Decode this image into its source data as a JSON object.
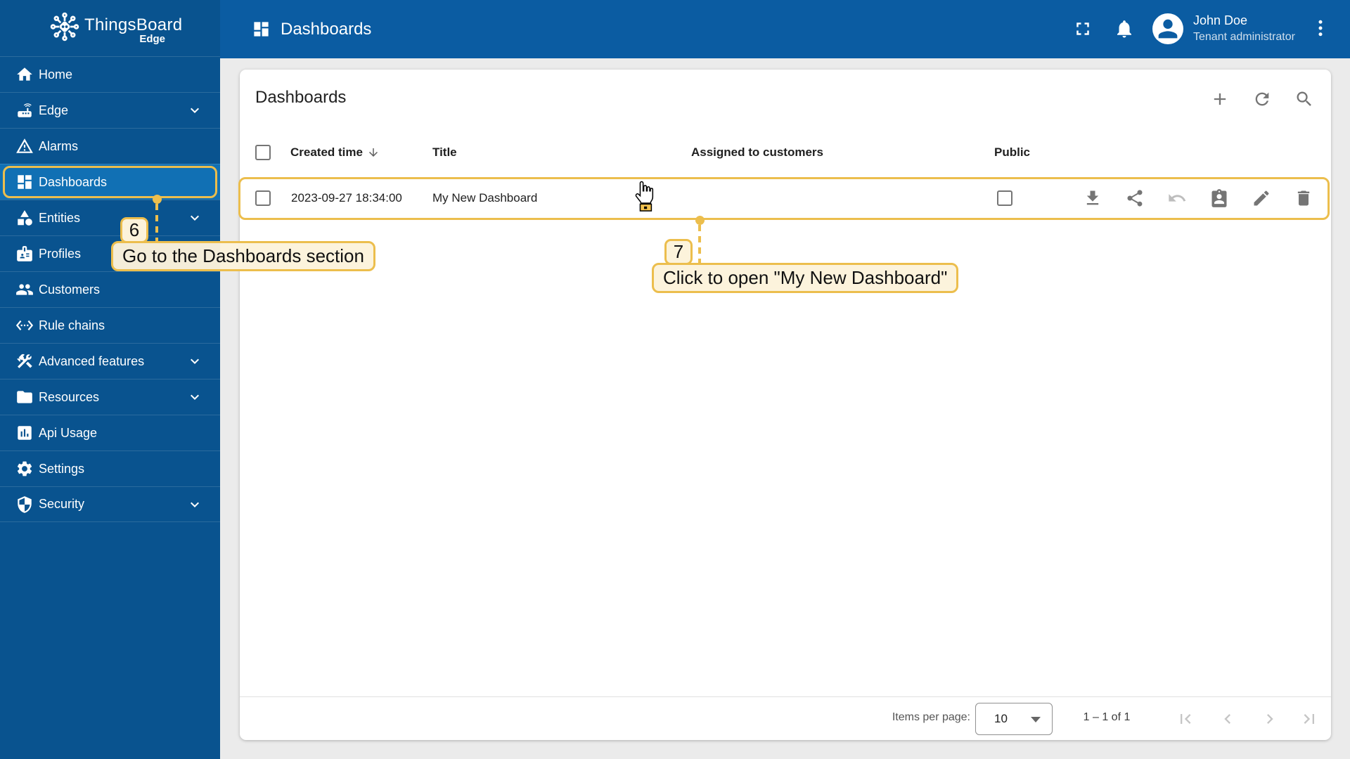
{
  "sidebar": {
    "logo": {
      "title": "ThingsBoard",
      "subtitle": "Edge"
    },
    "items": [
      {
        "label": "Home",
        "expandable": false,
        "selected": false
      },
      {
        "label": "Edge",
        "expandable": true,
        "selected": false
      },
      {
        "label": "Alarms",
        "expandable": false,
        "selected": false
      },
      {
        "label": "Dashboards",
        "expandable": false,
        "selected": true
      },
      {
        "label": "Entities",
        "expandable": true,
        "selected": false
      },
      {
        "label": "Profiles",
        "expandable": false,
        "selected": false
      },
      {
        "label": "Customers",
        "expandable": false,
        "selected": false
      },
      {
        "label": "Rule chains",
        "expandable": false,
        "selected": false
      },
      {
        "label": "Advanced features",
        "expandable": true,
        "selected": false
      },
      {
        "label": "Resources",
        "expandable": true,
        "selected": false
      },
      {
        "label": "Api Usage",
        "expandable": false,
        "selected": false
      },
      {
        "label": "Settings",
        "expandable": false,
        "selected": false
      },
      {
        "label": "Security",
        "expandable": true,
        "selected": false
      }
    ]
  },
  "header": {
    "title": "Dashboards",
    "user": {
      "name": "John Doe",
      "role": "Tenant administrator"
    }
  },
  "content": {
    "title": "Dashboards",
    "table": {
      "columns": {
        "created_time": "Created time",
        "title": "Title",
        "assigned": "Assigned to customers",
        "public": "Public"
      },
      "rows": [
        {
          "created_time": "2023-09-27 18:34:00",
          "title": "My New Dashboard",
          "assigned_to_customers": "",
          "public": false
        }
      ]
    },
    "pagination": {
      "items_per_page_label": "Items per page:",
      "items_per_page_value": "10",
      "range": "1 – 1 of 1"
    }
  },
  "annotations": {
    "steps": [
      {
        "number": "6",
        "label": "Go to the Dashboards section"
      },
      {
        "number": "7",
        "label": "Click to open \"My New Dashboard\""
      }
    ]
  },
  "colors": {
    "sidebar_bg": "#09538F",
    "header_bg": "#0B5CA2",
    "selected_item_bg": "#1170B4",
    "page_bg": "#EBEBEB",
    "annotation_border": "#ECBE4D",
    "annotation_fill": "#FCF3DB",
    "icon_gray": "#757575"
  },
  "icons": {
    "logo": "thingsboard-circuit-logo-icon",
    "sidebar": [
      "home-icon",
      "edge-router-icon",
      "alarms-warning-icon",
      "dashboards-grid-icon",
      "entities-shapes-icon",
      "profiles-badge-icon",
      "customers-people-icon",
      "rule-chains-ethernet-icon",
      "advanced-features-tools-icon",
      "resources-folder-icon",
      "api-usage-chart-icon",
      "settings-gear-icon",
      "security-shield-icon",
      "chevron-down-icon"
    ],
    "header": [
      "dashboards-grid-icon",
      "fullscreen-icon",
      "notifications-bell-icon",
      "avatar-person-icon",
      "more-vert-icon"
    ],
    "toolbar": [
      "add-icon",
      "refresh-icon",
      "search-icon"
    ],
    "table": [
      "checkbox",
      "sort-descending-arrow-icon"
    ],
    "row_actions": [
      "download-icon",
      "share-icon",
      "undo-icon",
      "assign-customer-icon",
      "edit-pencil-icon",
      "delete-trash-icon"
    ],
    "pagination": [
      "dropdown-arrow-icon",
      "first-page-icon",
      "previous-page-icon",
      "next-page-icon",
      "last-page-icon"
    ],
    "overlay": "hand-pointer-cursor"
  }
}
